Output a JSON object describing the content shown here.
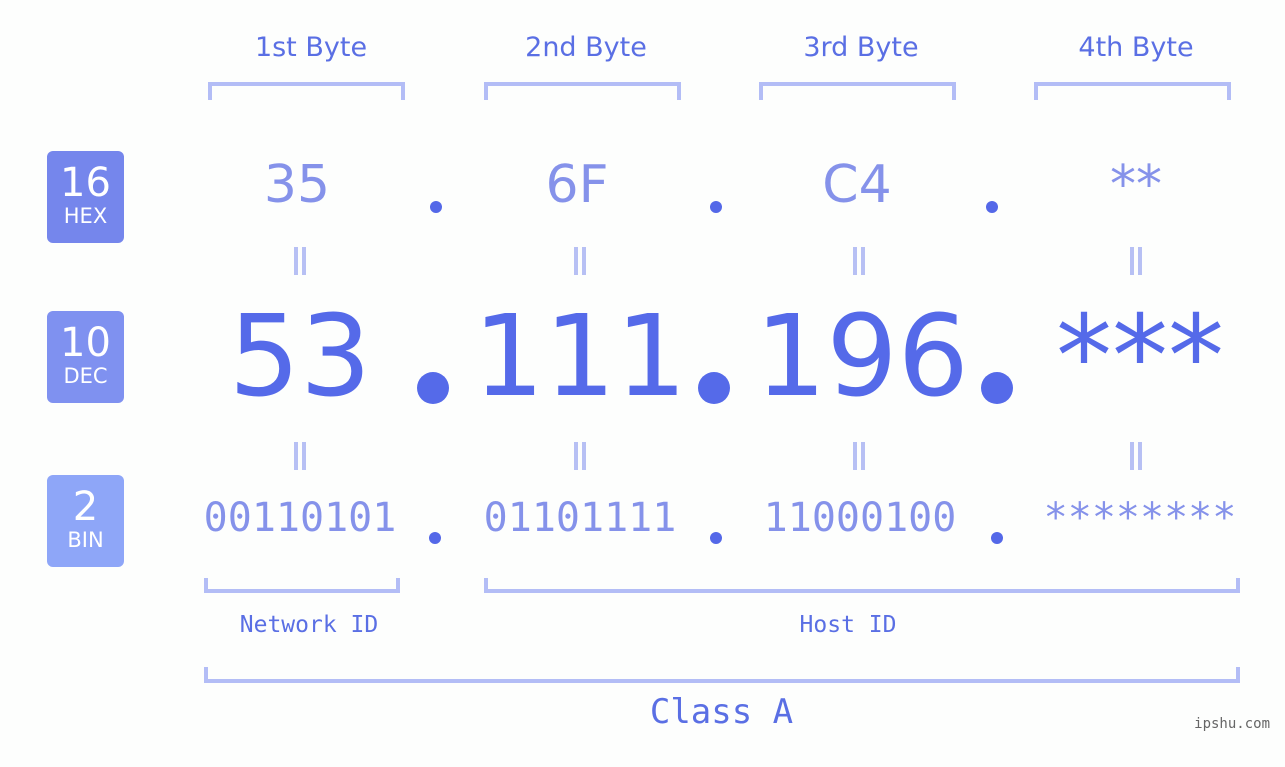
{
  "headers": [
    "1st Byte",
    "2nd Byte",
    "3rd Byte",
    "4th Byte"
  ],
  "badges": [
    {
      "number": "16",
      "label": "HEX",
      "color": "#7586ec"
    },
    {
      "number": "10",
      "label": "DEC",
      "color": "#7f91f0"
    },
    {
      "number": "2",
      "label": "BIN",
      "color": "#8ea6f8"
    }
  ],
  "hex": [
    "35",
    "6F",
    "C4",
    "**"
  ],
  "dec": [
    "53",
    "111",
    "196",
    "***"
  ],
  "bin": [
    "00110101",
    "01101111",
    "11000100",
    "********"
  ],
  "network_id_label": "Network ID",
  "host_id_label": "Host ID",
  "class_label": "Class A",
  "watermark": "ipshu.com",
  "colors": {
    "accent": "#556ae9",
    "light_value": "#8592ea",
    "bracket": "#b3bdf6",
    "background": "#fdfefd"
  }
}
